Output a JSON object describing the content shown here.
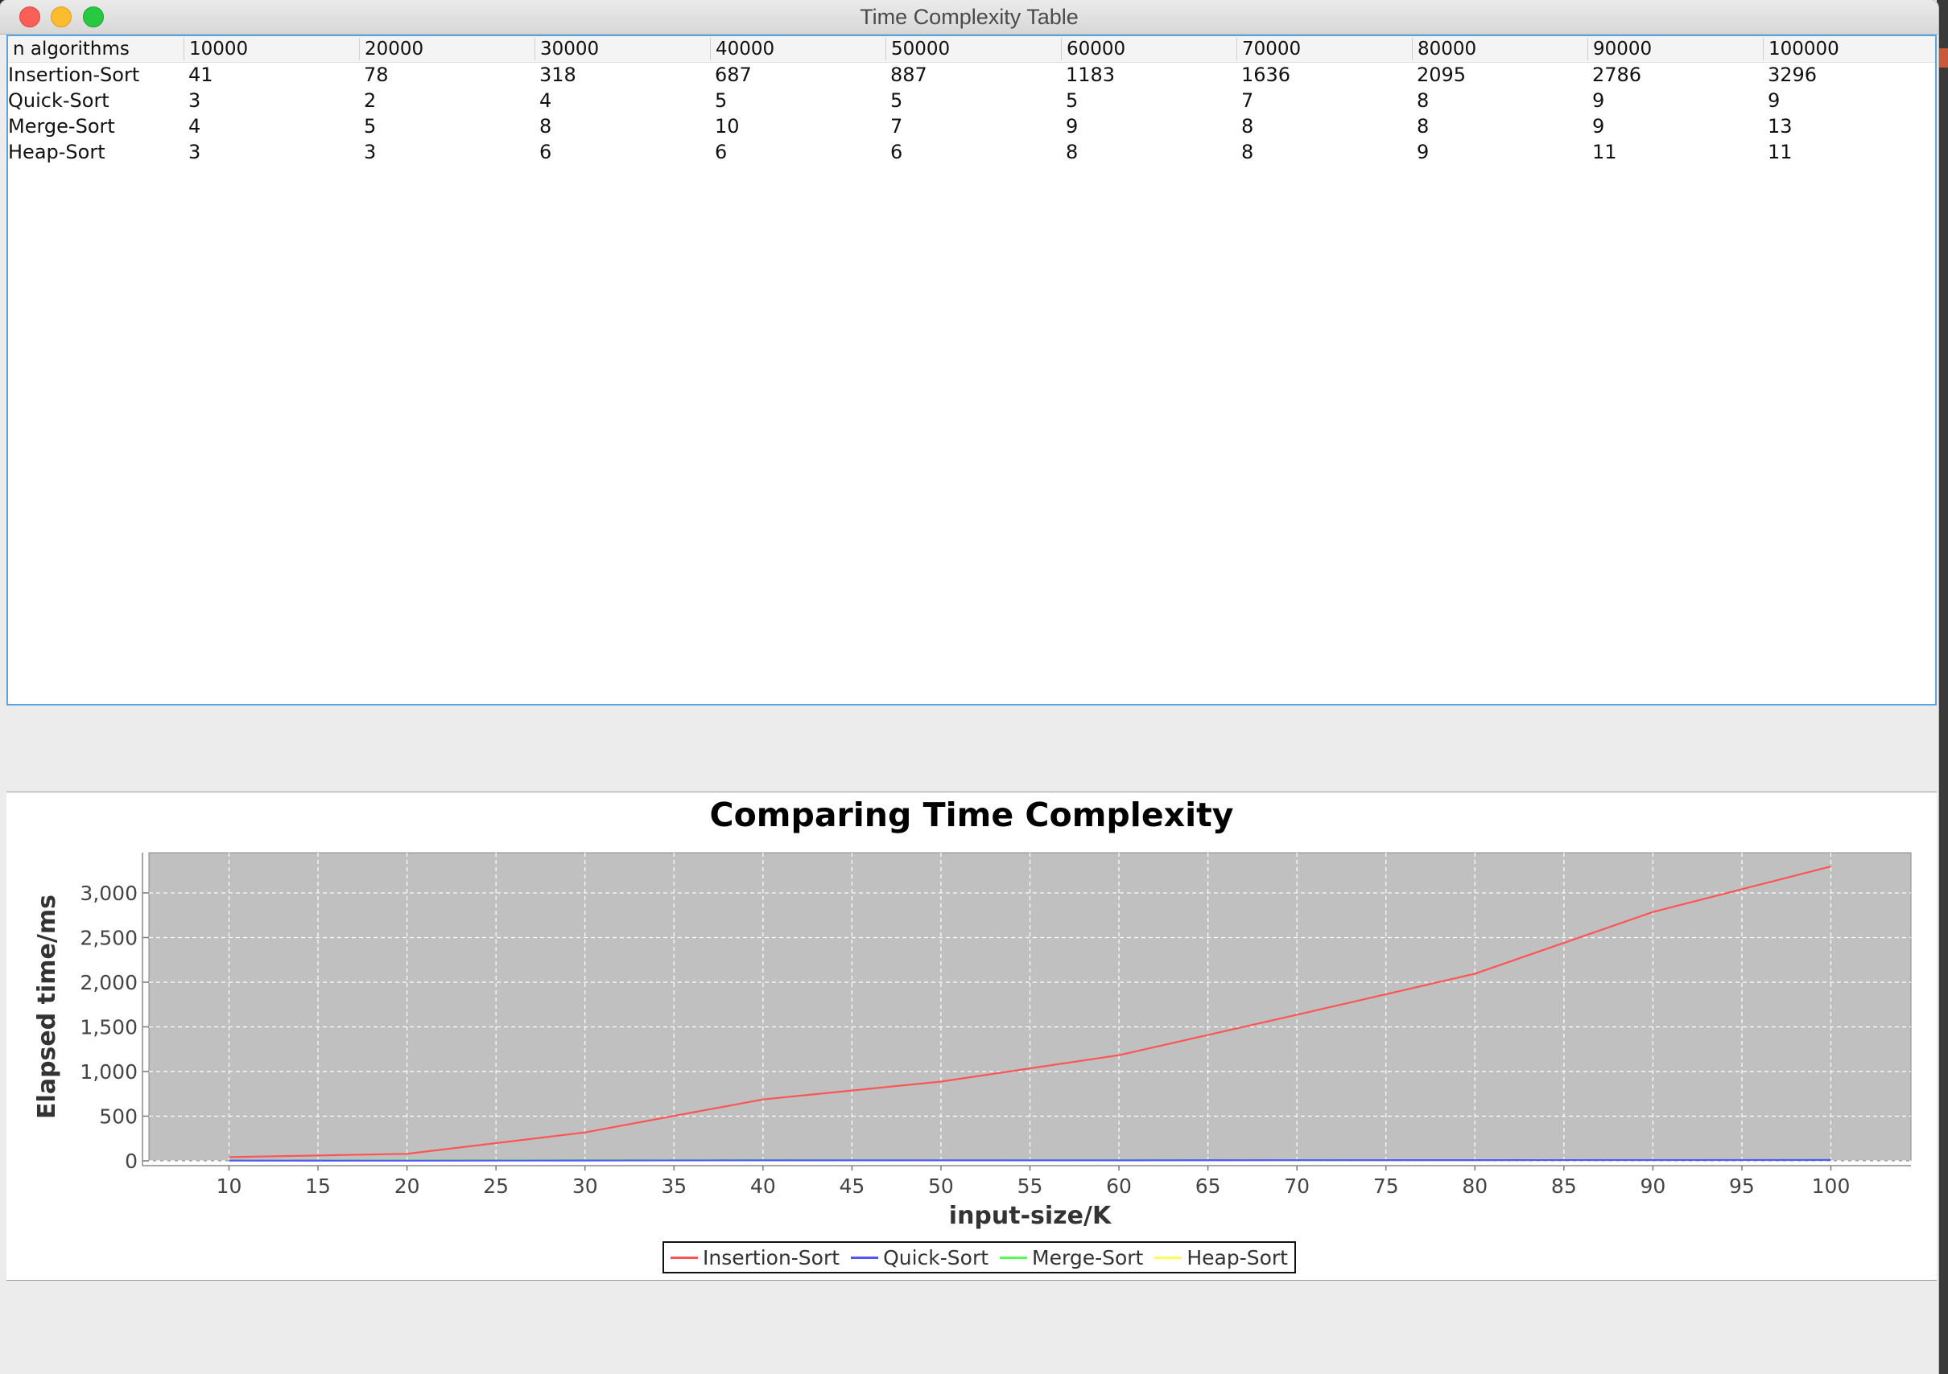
{
  "window": {
    "title": "Time Complexity Table"
  },
  "table": {
    "headers": [
      "n algorithms",
      "10000",
      "20000",
      "30000",
      "40000",
      "50000",
      "60000",
      "70000",
      "80000",
      "90000",
      "100000"
    ],
    "rows": [
      [
        "Insertion-Sort",
        "41",
        "78",
        "318",
        "687",
        "887",
        "1183",
        "1636",
        "2095",
        "2786",
        "3296"
      ],
      [
        "Quick-Sort",
        "3",
        "2",
        "4",
        "5",
        "5",
        "5",
        "7",
        "8",
        "9",
        "9"
      ],
      [
        "Merge-Sort",
        "4",
        "5",
        "8",
        "10",
        "7",
        "9",
        "8",
        "8",
        "9",
        "13"
      ],
      [
        "Heap-Sort",
        "3",
        "3",
        "6",
        "6",
        "6",
        "8",
        "8",
        "9",
        "11",
        "11"
      ]
    ]
  },
  "chart_data": {
    "type": "line",
    "title": "Comparing Time Complexity",
    "xlabel": "input-size/K",
    "ylabel": "Elapsed time/ms",
    "x": [
      10,
      20,
      30,
      40,
      50,
      60,
      70,
      80,
      90,
      100
    ],
    "x_ticks": [
      "10",
      "15",
      "20",
      "25",
      "30",
      "35",
      "40",
      "45",
      "50",
      "55",
      "60",
      "65",
      "70",
      "75",
      "80",
      "85",
      "90",
      "95",
      "100"
    ],
    "y_ticks": [
      "0",
      "500",
      "1,000",
      "1,500",
      "2,000",
      "2,500",
      "3,000"
    ],
    "xlim": [
      5.5,
      104.5
    ],
    "ylim": [
      0,
      3450
    ],
    "grid": true,
    "legend_position": "bottom",
    "background": "#c0c0c0",
    "series": [
      {
        "name": "Insertion-Sort",
        "color": "#ff5555",
        "values": [
          41,
          78,
          318,
          687,
          887,
          1183,
          1636,
          2095,
          2786,
          3296
        ]
      },
      {
        "name": "Quick-Sort",
        "color": "#5555ff",
        "values": [
          3,
          2,
          4,
          5,
          5,
          5,
          7,
          8,
          9,
          9
        ]
      },
      {
        "name": "Merge-Sort",
        "color": "#55ff55",
        "values": [
          4,
          5,
          8,
          10,
          7,
          9,
          8,
          8,
          9,
          13
        ]
      },
      {
        "name": "Heap-Sort",
        "color": "#ffff55",
        "values": [
          3,
          3,
          6,
          6,
          6,
          8,
          8,
          9,
          11,
          11
        ]
      }
    ]
  }
}
